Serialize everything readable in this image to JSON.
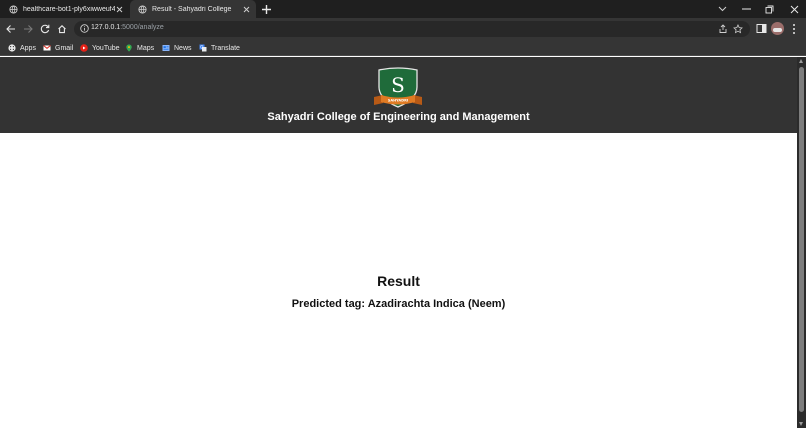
{
  "browser": {
    "tabs": [
      {
        "title": "healthcare-bot1-ply6xiwweuf4?..."
      },
      {
        "title": "Result - Sahyadri College"
      }
    ],
    "url_host": "127.0.0.1",
    "url_path": ":5000/analyze",
    "bookmarks": [
      {
        "label": "Apps"
      },
      {
        "label": "Gmail"
      },
      {
        "label": "YouTube"
      },
      {
        "label": "Maps"
      },
      {
        "label": "News"
      },
      {
        "label": "Translate"
      }
    ]
  },
  "page": {
    "logo_letter": "S",
    "logo_ribbon": "SAHYADRI",
    "college_name": "Sahyadri College of Engineering and Management",
    "result_title": "Result",
    "prediction": "Predicted tag: Azadirachta Indica (Neem)"
  },
  "colors": {
    "header_bg": "#333333",
    "shield_green": "#1f6b3a",
    "ribbon_orange": "#e07b24"
  }
}
